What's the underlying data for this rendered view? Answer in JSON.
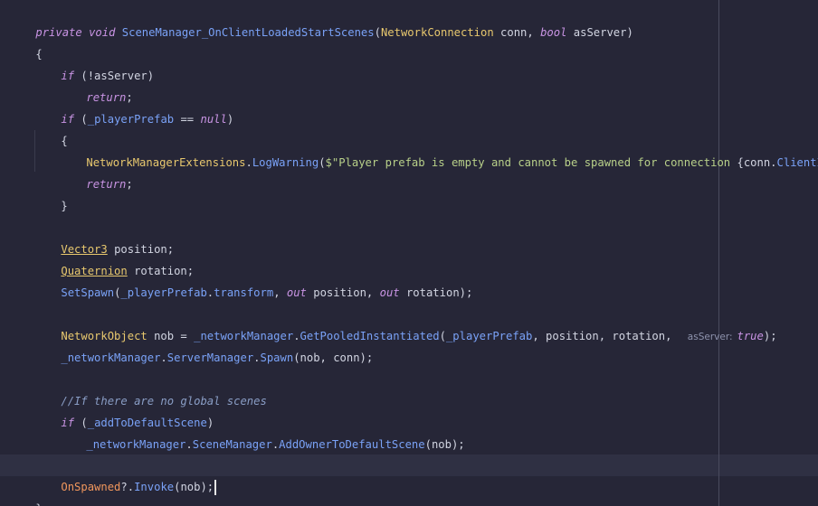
{
  "editor": {
    "l1": {
      "kw1": "private",
      "kw2": "void",
      "method": "SceneManager_OnClientLoadedStartScenes",
      "p1": "(",
      "type1": "NetworkConnection",
      "p2": " conn, ",
      "kw3": "bool",
      "p3": " asServer)"
    },
    "l2": {
      "text": "{"
    },
    "l3": {
      "kw": "if",
      "rest": " (!asServer)"
    },
    "l4": {
      "kw": "return",
      "rest": ";"
    },
    "l5": {
      "kw": "if",
      "p1": " (",
      "field": "_playerPrefab",
      "p2": " == ",
      "kw2": "null",
      "p3": ")"
    },
    "l6": {
      "text": "{"
    },
    "l7": {
      "type": "NetworkManagerExtensions",
      "dot": ".",
      "method": "LogWarning",
      "p1": "(",
      "str1": "$\"Player prefab is empty and cannot be spawned for connection ",
      "interp_open": "{",
      "var": "conn",
      "dot2": ".",
      "prop": "ClientId",
      "interp_close": "}",
      "str2": ".\"",
      "p2": ");"
    },
    "l8": {
      "kw": "return",
      "rest": ";"
    },
    "l9": {
      "text": "}"
    },
    "l10": {
      "type": "Vector3",
      "rest": " position;"
    },
    "l11": {
      "type": "Quaternion",
      "rest": " rotation;"
    },
    "l12": {
      "method": "SetSpawn",
      "p1": "(",
      "field": "_playerPrefab",
      "p2": ".",
      "prop": "transform",
      "p3": ", ",
      "kw1": "out",
      "p4": " position, ",
      "kw2": "out",
      "p5": " rotation);"
    },
    "l13": {
      "type": "NetworkObject",
      "p1": " nob = ",
      "field": "_networkManager",
      "p2": ".",
      "method": "GetPooledInstantiated",
      "p3": "(",
      "field2": "_playerPrefab",
      "p4": ", position, rotation, ",
      "hint": "asServer:",
      "kw": "true",
      "p5": ");"
    },
    "l14": {
      "field": "_networkManager",
      "p1": ".",
      "prop": "ServerManager",
      "p2": ".",
      "method": "Spawn",
      "p3": "(nob, conn);"
    },
    "l15": {
      "comment": "//If there are no global scenes"
    },
    "l16": {
      "kw": "if",
      "p1": " (",
      "field": "_addToDefaultScene",
      "p2": ")"
    },
    "l17": {
      "field": "_networkManager",
      "p1": ".",
      "prop": "SceneManager",
      "p2": ".",
      "method": "AddOwnerToDefaultScene",
      "p3": "(nob);"
    },
    "l18": {
      "event": "OnSpawned",
      "p1": "?.",
      "method": "Invoke",
      "p2": "(nob);"
    },
    "l19": {
      "text": "}"
    }
  }
}
